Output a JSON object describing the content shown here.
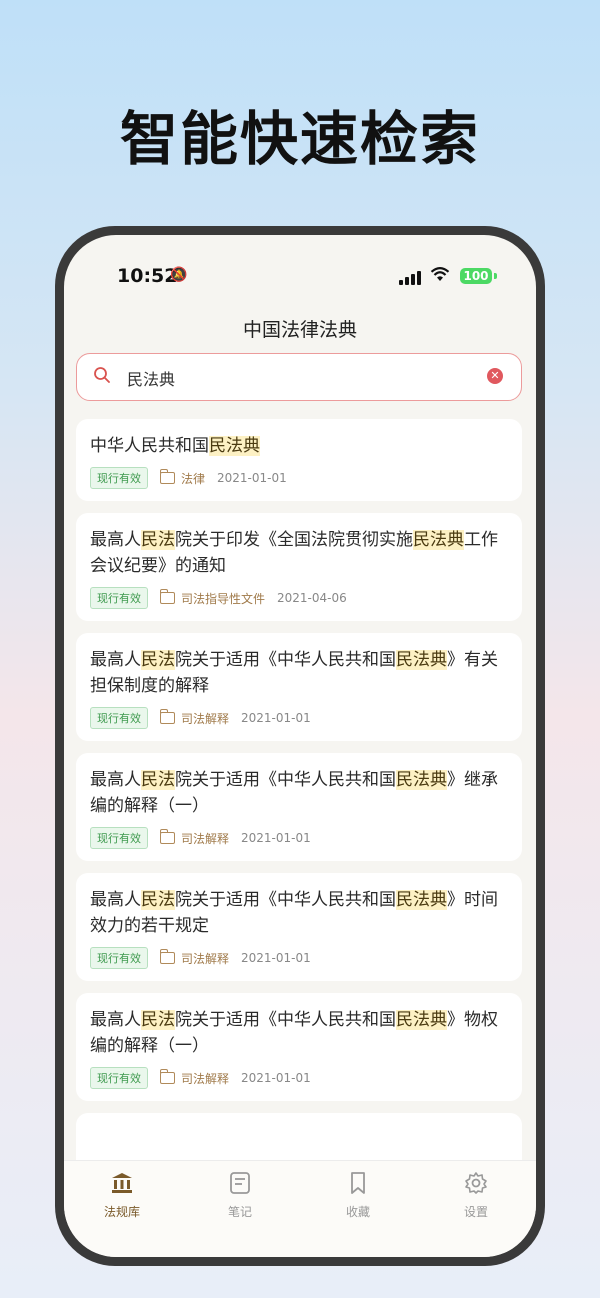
{
  "headline": "智能快速检索",
  "status_bar": {
    "time": "10:52",
    "battery": "100"
  },
  "nav": {
    "title": "中国法律法典"
  },
  "search": {
    "value": "民法典"
  },
  "results": [
    {
      "title_parts": [
        {
          "t": "中华人民共和国",
          "hl": false
        },
        {
          "t": "民法典",
          "hl": true
        }
      ],
      "status": "现行有效",
      "category": "法律",
      "date": "2021-01-01"
    },
    {
      "title_parts": [
        {
          "t": "最高人",
          "hl": false
        },
        {
          "t": "民法",
          "hl": true
        },
        {
          "t": "院关于印发《全国法院贯彻实施",
          "hl": false
        },
        {
          "t": "民法典",
          "hl": true
        },
        {
          "t": "工作会议纪要》的通知",
          "hl": false
        }
      ],
      "status": "现行有效",
      "category": "司法指导性文件",
      "date": "2021-04-06"
    },
    {
      "title_parts": [
        {
          "t": "最高人",
          "hl": false
        },
        {
          "t": "民法",
          "hl": true
        },
        {
          "t": "院关于适用《中华人民共和国",
          "hl": false
        },
        {
          "t": "民法典",
          "hl": true
        },
        {
          "t": "》有关担保制度的解释",
          "hl": false
        }
      ],
      "status": "现行有效",
      "category": "司法解释",
      "date": "2021-01-01"
    },
    {
      "title_parts": [
        {
          "t": "最高人",
          "hl": false
        },
        {
          "t": "民法",
          "hl": true
        },
        {
          "t": "院关于适用《中华人民共和国",
          "hl": false
        },
        {
          "t": "民法典",
          "hl": true
        },
        {
          "t": "》继承编的解释（一）",
          "hl": false
        }
      ],
      "status": "现行有效",
      "category": "司法解释",
      "date": "2021-01-01"
    },
    {
      "title_parts": [
        {
          "t": "最高人",
          "hl": false
        },
        {
          "t": "民法",
          "hl": true
        },
        {
          "t": "院关于适用《中华人民共和国",
          "hl": false
        },
        {
          "t": "民法典",
          "hl": true
        },
        {
          "t": "》时间效力的若干规定",
          "hl": false
        }
      ],
      "status": "现行有效",
      "category": "司法解释",
      "date": "2021-01-01"
    },
    {
      "title_parts": [
        {
          "t": "最高人",
          "hl": false
        },
        {
          "t": "民法",
          "hl": true
        },
        {
          "t": "院关于适用《中华人民共和国",
          "hl": false
        },
        {
          "t": "民法典",
          "hl": true
        },
        {
          "t": "》物权编的解释（一）",
          "hl": false
        }
      ],
      "status": "现行有效",
      "category": "司法解释",
      "date": "2021-01-01"
    }
  ],
  "tabbar": [
    {
      "label": "法规库",
      "icon": "library-icon",
      "active": true
    },
    {
      "label": "笔记",
      "icon": "note-icon",
      "active": false
    },
    {
      "label": "收藏",
      "icon": "bookmark-icon",
      "active": false
    },
    {
      "label": "设置",
      "icon": "gear-icon",
      "active": false
    }
  ],
  "colors": {
    "accent": "#7a5a2a",
    "highlight": "#fdf1c4",
    "status_green": "#3e9a4e",
    "search_border": "#ec9b9b"
  }
}
